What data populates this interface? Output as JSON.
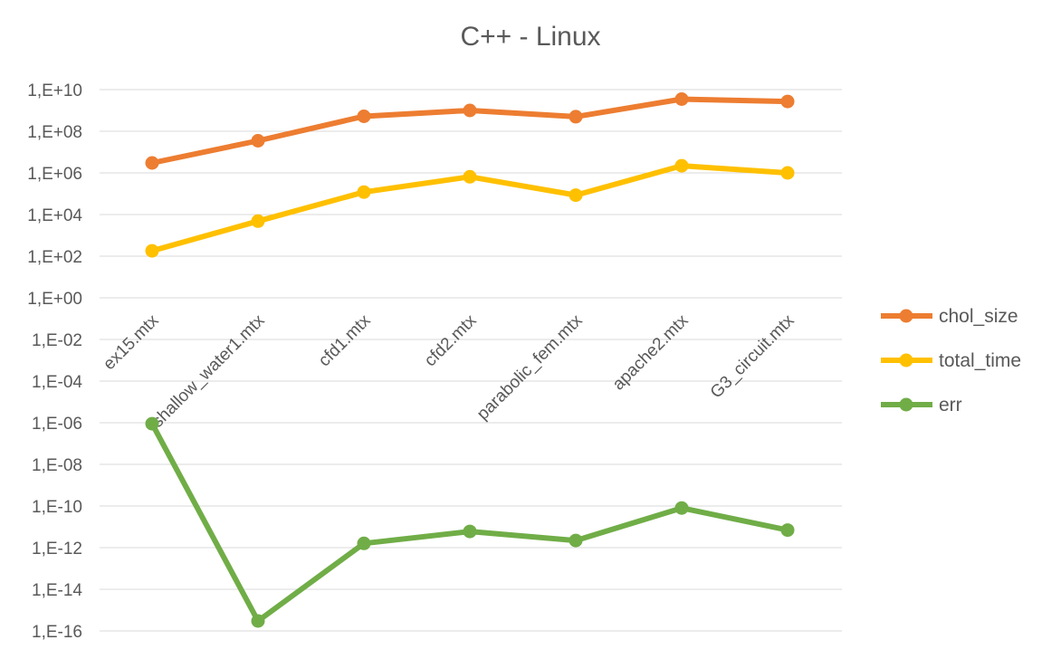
{
  "chart_data": {
    "type": "line",
    "title": "C++ - Linux",
    "xlabel": "",
    "ylabel": "",
    "y_scale": "log10",
    "ylim": [
      1e-16,
      10000000000.0
    ],
    "y_ticks": [
      "1,E+10",
      "1,E+08",
      "1,E+06",
      "1,E+04",
      "1,E+02",
      "1,E+00",
      "1,E-02",
      "1,E-04",
      "1,E-06",
      "1,E-08",
      "1,E-10",
      "1,E-12",
      "1,E-14",
      "1,E-16"
    ],
    "categories": [
      "ex15.mtx",
      "shallow_water1.mtx",
      "cfd1.mtx",
      "cfd2.mtx",
      "parabolic_fem.mtx",
      "apache2.mtx",
      "G3_circuit.mtx"
    ],
    "grid": true,
    "legend_position": "right",
    "series": [
      {
        "name": "chol_size",
        "color": "#ED7D31",
        "values": [
          3000000.0,
          35000000.0,
          520000000.0,
          1000000000.0,
          500000000.0,
          3500000000.0,
          2700000000.0
        ]
      },
      {
        "name": "total_time",
        "color": "#FFC000",
        "values": [
          180,
          4800,
          120000.0,
          650000.0,
          85000.0,
          2200000.0,
          1000000.0
        ]
      },
      {
        "name": "err",
        "color": "#70AD47",
        "values": [
          9e-07,
          3e-16,
          1.6e-12,
          6e-12,
          2.2e-12,
          8e-11,
          7e-12
        ]
      }
    ]
  }
}
